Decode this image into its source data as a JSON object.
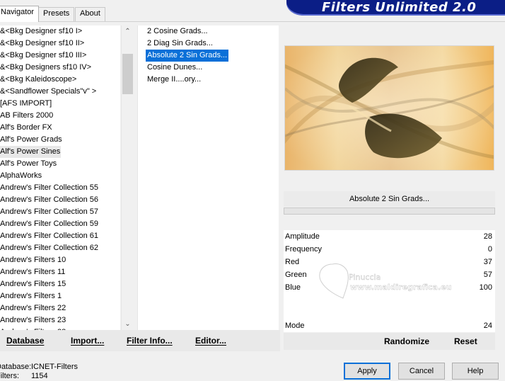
{
  "tabs": [
    {
      "label": "Navigator",
      "active": true
    },
    {
      "label": "Presets",
      "active": false
    },
    {
      "label": "About",
      "active": false
    }
  ],
  "banner": {
    "title": "Filters Unlimited 2.0"
  },
  "categories": [
    "&<Bkg Designer sf10 I>",
    "&<Bkg Designer sf10 II>",
    "&<Bkg Designer sf10 III>",
    "&<Bkg Designers sf10 IV>",
    "&<Bkg Kaleidoscope>",
    "&<Sandflower Specials\"v\" >",
    "[AFS IMPORT]",
    "AB Filters 2000",
    "Alf's Border FX",
    "Alf's Power Grads",
    "Alf's Power Sines",
    "Alf's Power Toys",
    "AlphaWorks",
    "Andrew's Filter Collection 55",
    "Andrew's Filter Collection 56",
    "Andrew's Filter Collection 57",
    "Andrew's Filter Collection 59",
    "Andrew's Filter Collection 61",
    "Andrew's Filter Collection 62",
    "Andrew's Filters 10",
    "Andrew's Filters 11",
    "Andrew's Filters 15",
    "Andrew's Filters 1",
    "Andrew's Filters 22",
    "Andrew's Filters 23",
    "Andrew's Filters 23"
  ],
  "selected_category_index": 10,
  "filters": [
    "2 Cosine Grads...",
    "2 Diag Sin Grads...",
    "Absolute 2 Sin Grads...",
    "Cosine Dunes...",
    "Merge II....ory..."
  ],
  "selected_filter_index": 2,
  "left_buttons": {
    "database": "Database",
    "import": "Import...",
    "filter_info": "Filter Info...",
    "editor": "Editor..."
  },
  "filter_name": "Absolute 2 Sin Grads...",
  "params": [
    {
      "label": "Amplitude",
      "value": "28"
    },
    {
      "label": "Frequency",
      "value": "0"
    },
    {
      "label": "Red",
      "value": "37"
    },
    {
      "label": "Green",
      "value": "57"
    },
    {
      "label": "Blue",
      "value": "100"
    },
    {
      "label": "Mode",
      "value": "24"
    }
  ],
  "right_buttons": {
    "randomize": "Randomize",
    "reset": "Reset"
  },
  "status": {
    "database_label": "Database:",
    "database_value": "ICNET-Filters",
    "filters_label": "Filters:",
    "filters_value": "1154"
  },
  "dialog_buttons": {
    "apply": "Apply",
    "cancel": "Cancel",
    "help": "Help"
  },
  "watermark": {
    "line1": "Pinuccia",
    "line2": "www.maldiregrafica.eu"
  },
  "colors": {
    "banner": "#0b1e86",
    "selection": "#0a70d8",
    "default_button_border": "#0a70d8"
  }
}
